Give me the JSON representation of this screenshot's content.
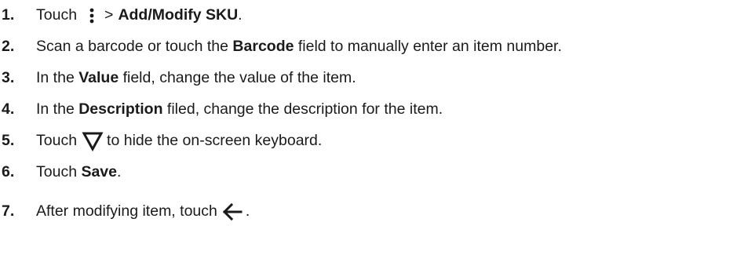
{
  "steps": [
    {
      "num": "1.",
      "parts": {
        "a": "Touch",
        "b": ">",
        "c": "Add/Modify SKU",
        "d": "."
      },
      "icon": "more-vert-icon"
    },
    {
      "num": "2.",
      "parts": {
        "a": "Scan a barcode or touch the ",
        "b": "Barcode",
        "c": " field to manually enter an item number."
      }
    },
    {
      "num": "3.",
      "parts": {
        "a": "In the ",
        "b": "Value",
        "c": " field, change the value of the item."
      }
    },
    {
      "num": "4.",
      "parts": {
        "a": "In the ",
        "b": "Description",
        "c": " filed, change the description for the item."
      }
    },
    {
      "num": "5.",
      "parts": {
        "a": "Touch",
        "b": "to hide the on-screen keyboard."
      },
      "icon": "triangle-down-icon"
    },
    {
      "num": "6.",
      "parts": {
        "a": "Touch ",
        "b": "Save",
        "c": "."
      }
    },
    {
      "num": "7.",
      "parts": {
        "a": "After modifying item, touch",
        "b": "."
      },
      "icon": "arrow-left-icon"
    }
  ],
  "colors": {
    "text": "#1a1a1a",
    "background": "#ffffff"
  }
}
